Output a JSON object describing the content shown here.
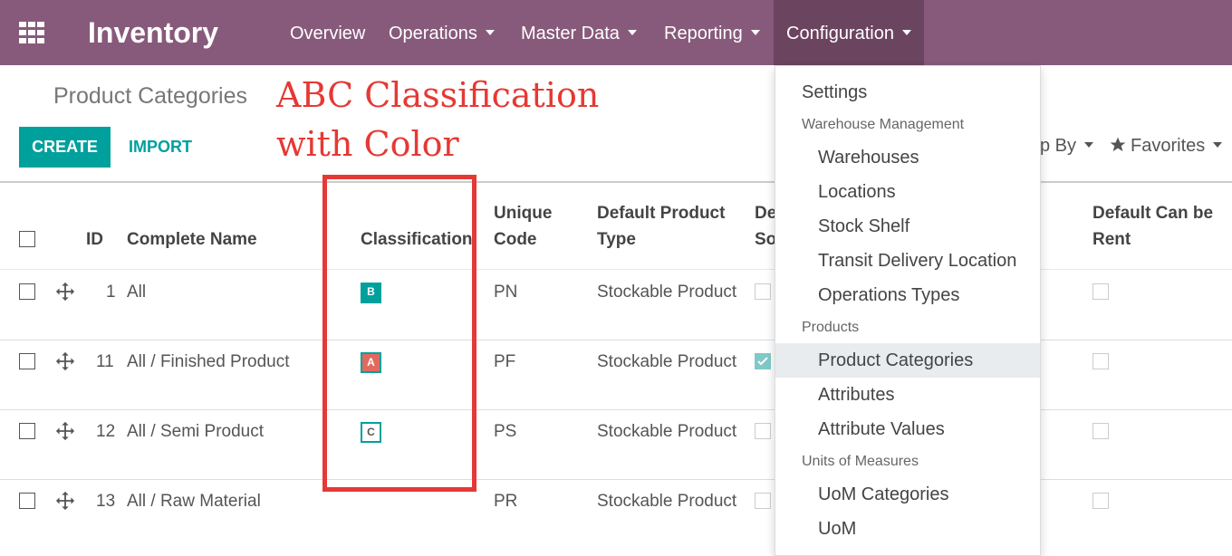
{
  "navbar": {
    "brand": "Inventory",
    "menu": [
      "Overview",
      "Operations",
      "Master Data",
      "Reporting",
      "Configuration"
    ]
  },
  "control_panel": {
    "title": "Product Categories",
    "create_label": "CREATE",
    "import_label": "IMPORT",
    "groupby_label": "p By",
    "favorites_label": "Favorites"
  },
  "annotation": {
    "line1": "ABC Classification",
    "line2": "with Color"
  },
  "table": {
    "headers": {
      "id": "ID",
      "complete_name": "Complete Name",
      "classification": "Classification",
      "unique_code_1": "Unique",
      "unique_code_2": "Code",
      "product_type_1": "Default Product",
      "product_type_2": "Type",
      "partial_1": "De",
      "partial_2": "So",
      "rent_1": "Default Can be",
      "rent_2": "Rent"
    },
    "rows": [
      {
        "id": "1",
        "name": "All",
        "class": "B",
        "code": "PN",
        "type": "Stockable Product"
      },
      {
        "id": "11",
        "name": "All / Finished Product",
        "class": "A",
        "code": "PF",
        "type": "Stockable Product"
      },
      {
        "id": "12",
        "name": "All / Semi Product",
        "class": "C",
        "code": "PS",
        "type": "Stockable Product"
      },
      {
        "id": "13",
        "name": "All / Raw Material",
        "class": "",
        "code": "PR",
        "type": "Stockable Product"
      }
    ]
  },
  "dropdown": {
    "settings": "Settings",
    "warehouse_header": "Warehouse Management",
    "warehouses": "Warehouses",
    "locations": "Locations",
    "stock_shelf": "Stock Shelf",
    "transit": "Transit Delivery Location",
    "operation_types": "Operations Types",
    "products_header": "Products",
    "product_categories": "Product Categories",
    "attributes": "Attributes",
    "attribute_values": "Attribute Values",
    "uom_header": "Units of Measures",
    "uom_categories": "UoM Categories",
    "uom": "UoM"
  },
  "colors": {
    "navbar": "#875a7b",
    "primary": "#00a09d",
    "badge_a": "#e06a60",
    "badge_b": "#00a09d",
    "badge_c_border": "#00a09d",
    "annotation": "#e53935"
  }
}
